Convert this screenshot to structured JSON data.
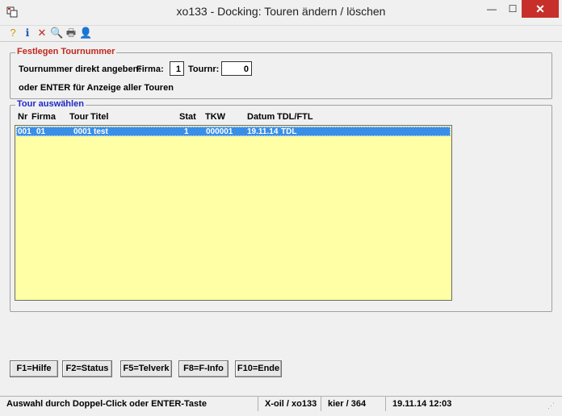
{
  "window": {
    "title": "xo133 - Docking: Touren ändern / löschen",
    "minimize": "—",
    "maximize": "☐",
    "close": "✕"
  },
  "toolbar": {
    "icons": [
      "help-icon",
      "info-icon",
      "delete-icon",
      "find-icon",
      "print-icon",
      "user-icon"
    ],
    "glyphs": [
      "?",
      "ℹ",
      "✕",
      "🔍",
      "🖶",
      "👤"
    ],
    "colors": [
      "#c99a00",
      "#1e5bb8",
      "#c0281e",
      "#7a5c1e",
      "#5a5a5a",
      "#c87a1e"
    ]
  },
  "festlegen": {
    "legend": "Festlegen Tournummer",
    "prompt": "Tournummer direkt angeben:",
    "firma_label": "Firma:",
    "firma_value": "1",
    "tournr_label": "Tournr:",
    "tournr_value": "0",
    "enter_hint": "oder ENTER für Anzeige aller Touren"
  },
  "tour": {
    "legend": "Tour auswählen",
    "columns": [
      "Nr",
      "Firma",
      "Tour",
      "Titel",
      "Stat",
      "TKW",
      "Datum",
      "TDL/FTL"
    ],
    "rows": [
      [
        "001",
        "01",
        "0001",
        "test",
        "1",
        "000001",
        "19.11.14",
        "TDL"
      ]
    ]
  },
  "fkeys": [
    "F1=Hilfe",
    "F2=Status",
    "F5=Telverk",
    "F8=F-Info",
    "F10=Ende"
  ],
  "statusbar": {
    "message": "Auswahl durch Doppel-Click oder ENTER-Taste",
    "app": "X-oil / xo133",
    "user": "kier / 364",
    "datetime": "19.11.14 12:03"
  },
  "colors": {
    "legend_red": "#c0281e",
    "legend_blue": "#1e28c8",
    "list_bg": "#ffffa6",
    "selection": "#3a8ee6"
  }
}
